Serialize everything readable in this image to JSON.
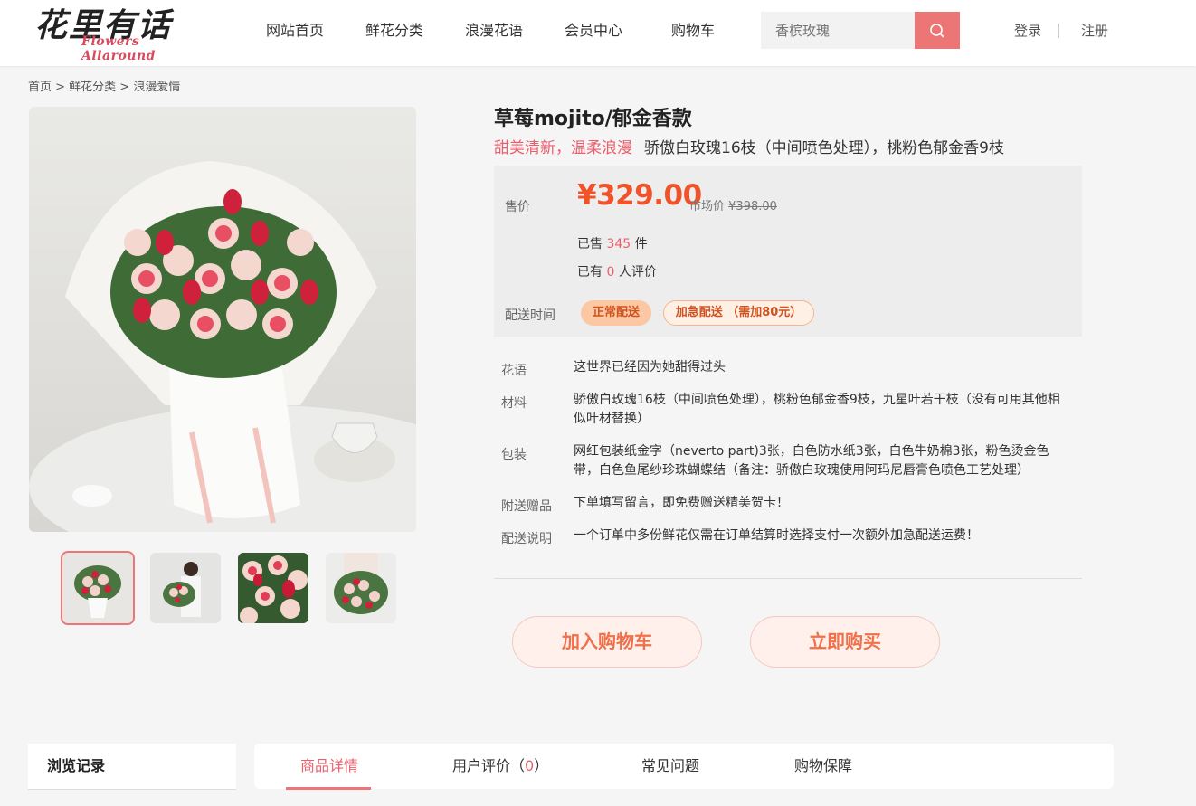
{
  "header": {
    "logo_cn": "花里有话",
    "logo_en": "Flowers Allaround",
    "nav": [
      "网站首页",
      "鲜花分类",
      "浪漫花语",
      "会员中心",
      "购物车"
    ],
    "search_placeholder": "香槟玫瑰",
    "login": "登录",
    "register": "注册"
  },
  "breadcrumb": "首页 > 鲜花分类 > 浪漫爱情",
  "product": {
    "title": "草莓mojito/郁金香款",
    "slogan": "甜美清新，温柔浪漫",
    "subtitle": "骄傲白玫瑰16枝（中间喷色处理），桃粉色郁金香9枝",
    "price_label": "售价",
    "price": "¥329.00",
    "market_label": "市场价",
    "market_price": "¥398.00",
    "sold_prefix": "已售",
    "sold": "345",
    "sold_unit": "件",
    "review_prefix": "已有",
    "reviews": "0",
    "review_suffix": "人评价",
    "delivery_label": "配送时间",
    "delivery_options": [
      "正常配送",
      "加急配送 （需加80元）"
    ],
    "details": [
      {
        "label": "花语",
        "value": "这世界已经因为她甜得过头"
      },
      {
        "label": "材料",
        "value": "骄傲白玫瑰16枝（中间喷色处理），桃粉色郁金香9枝，九星叶若干枝（没有可用其他相似叶材替换）"
      },
      {
        "label": "包装",
        "value": "网红包装纸金字（neverto part)3张，白色防水纸3张，白色牛奶棉3张，粉色烫金色带，白色鱼尾纱珍珠蝴蝶结（备注：骄傲白玫瑰使用阿玛尼唇膏色喷色工艺处理）"
      },
      {
        "label": "附送赠品",
        "value": "下单填写留言，即免费赠送精美贺卡！"
      },
      {
        "label": "配送说明",
        "value": "一个订单中多份鲜花仅需在订单结算时选择支付一次额外加急配送运费！"
      }
    ],
    "add_to_cart": "加入购物车",
    "buy_now": "立即购买"
  },
  "bottom": {
    "history": "浏览记录",
    "tabs": [
      "商品详情",
      "用户评价（",
      "常见问题",
      "购物保障"
    ],
    "review_count": "0",
    "review_close": "）"
  },
  "colors": {
    "accent": "#ec7676",
    "price": "#f0522a",
    "highlight": "#ec5e6c"
  }
}
